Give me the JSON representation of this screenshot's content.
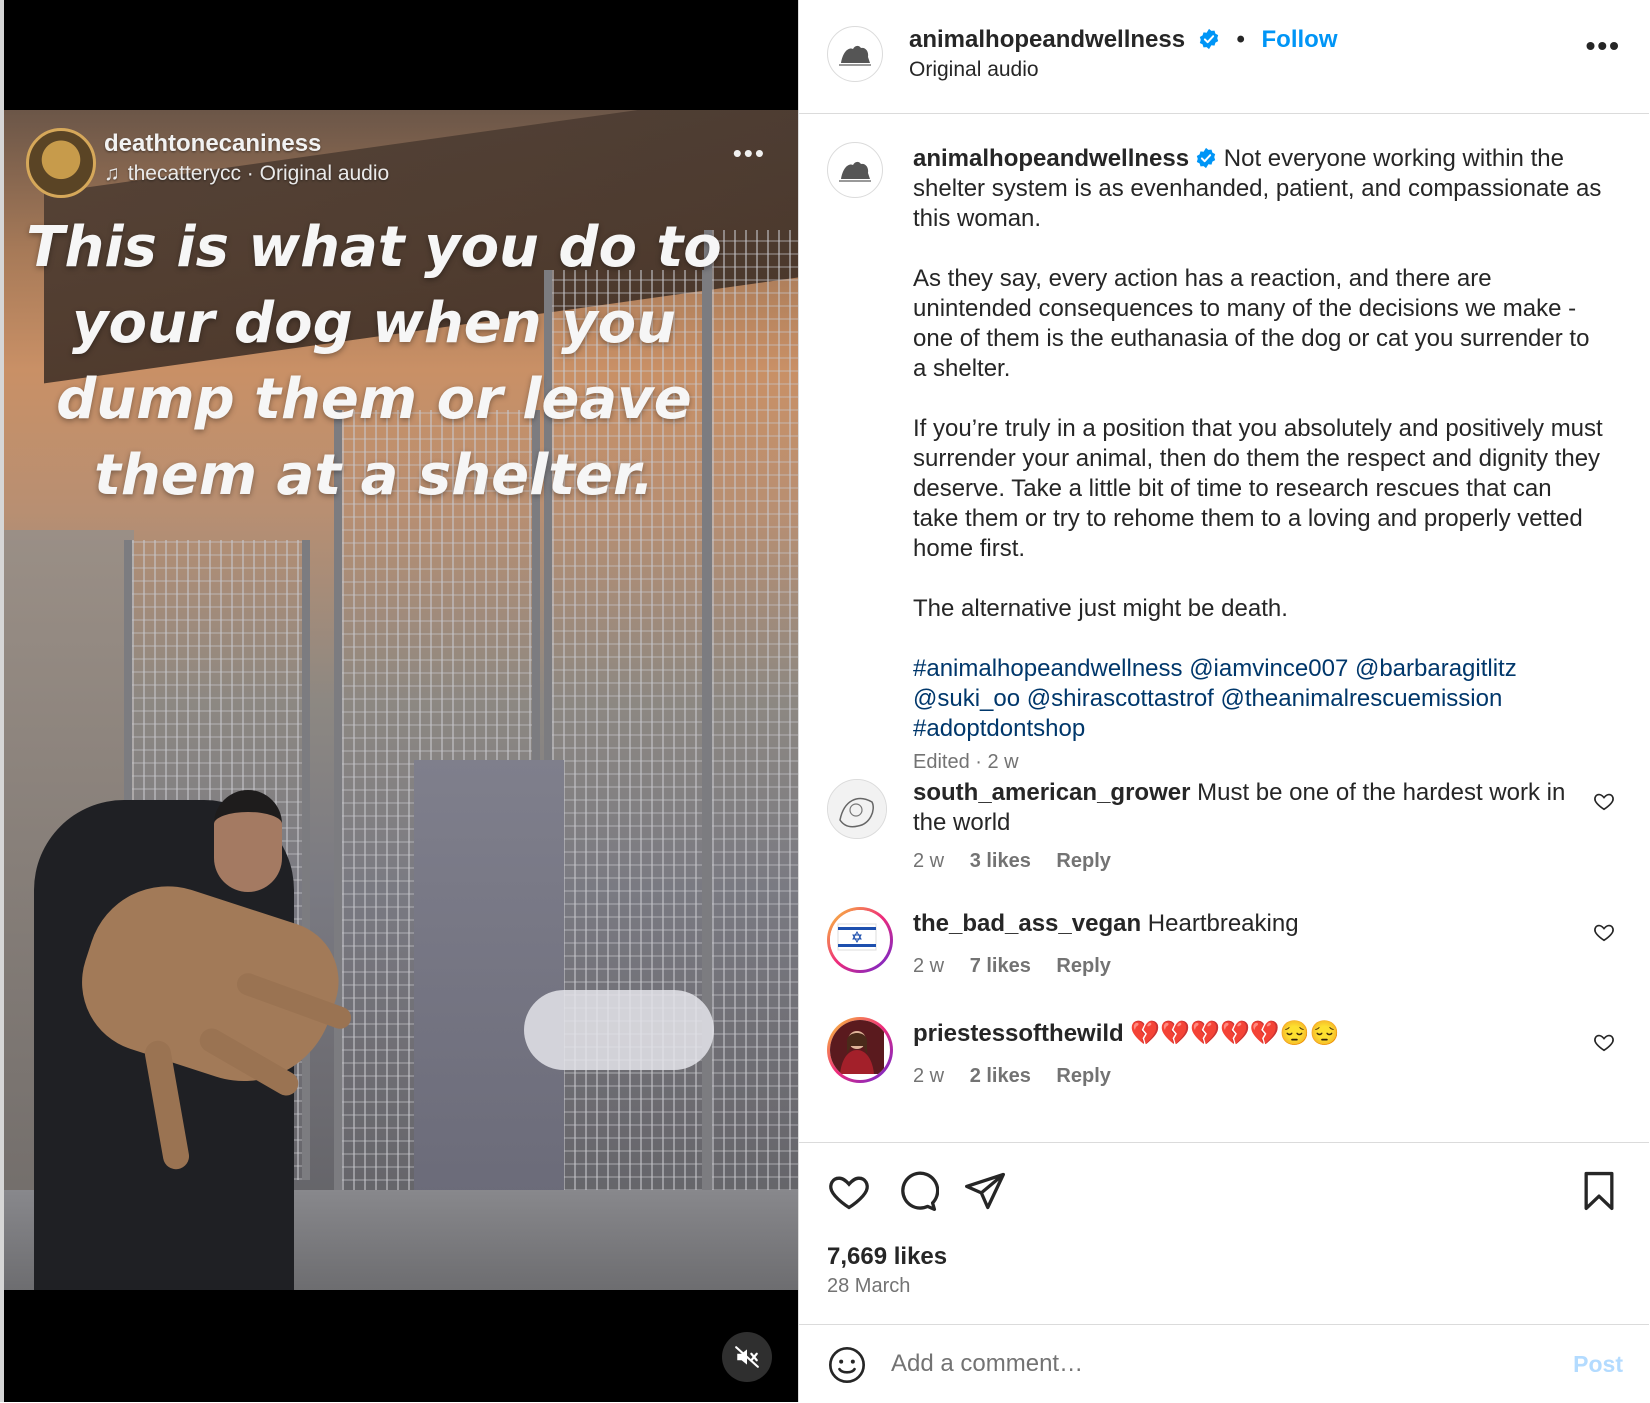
{
  "video": {
    "username": "deathtonecaniness",
    "audio": "thecatterycc · Original audio",
    "overlay_text": "This is what you do to your dog when you dump them or leave them at a shelter."
  },
  "header": {
    "username": "animalhopeandwellness",
    "separator": "•",
    "follow_label": "Follow",
    "audio": "Original audio",
    "more": "•••"
  },
  "caption": {
    "username": "animalhopeandwellness",
    "p1": "Not everyone working within the shelter system is as evenhanded, patient, and compassionate as this woman.",
    "p2": "As they say, every action has a reaction, and there are unintended consequences to many of the decisions we make - one of them is the euthanasia of the dog or cat you surrender to a shelter.",
    "p3": "If you’re truly in a position that you absolutely and positively must surrender your animal, then do them the respect and dignity they deserve. Take a little bit of time to research rescues that can take them or try to rehome them to a loving and properly vetted home first.",
    "p4": "The alternative just might be death.",
    "tags": "#animalhopeandwellness @iamvince007 @barbaragitlitz @suki_oo @shirascottastrof @theanimalrescuemission #adoptdontshop",
    "meta": "Edited · 2 w"
  },
  "comments": [
    {
      "username": "south_american_grower",
      "text": "Must be one of the hardest work in the world",
      "time": "2 w",
      "likes": "3 likes",
      "reply": "Reply"
    },
    {
      "username": "the_bad_ass_vegan",
      "text": "Heartbreaking",
      "time": "2 w",
      "likes": "7 likes",
      "reply": "Reply"
    },
    {
      "username": "priestessofthewild",
      "text": "💔💔💔💔💔😔😔",
      "time": "2 w",
      "likes": "2 likes",
      "reply": "Reply"
    }
  ],
  "footer": {
    "likes": "7,669 likes",
    "date": "28 March",
    "comment_placeholder": "Add a comment…",
    "post_label": "Post"
  },
  "colors": {
    "accent": "#0095f6",
    "link": "#00376b",
    "muted": "#737373",
    "border": "#dbdbdb"
  },
  "icons": [
    "verified-badge-icon",
    "heart-icon",
    "comment-icon",
    "share-icon",
    "bookmark-icon",
    "emoji-icon",
    "mute-icon",
    "music-note-icon",
    "more-icon"
  ]
}
